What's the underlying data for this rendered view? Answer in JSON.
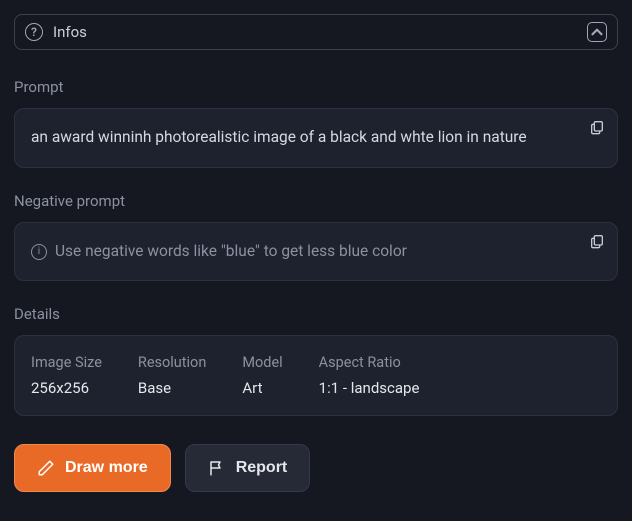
{
  "panel": {
    "title": "Infos"
  },
  "prompt": {
    "label": "Prompt",
    "value": "an award winninh photorealistic image of a black and whte lion in nature"
  },
  "negative_prompt": {
    "label": "Negative prompt",
    "placeholder": "Use negative words like \"blue\" to get less blue color"
  },
  "details": {
    "label": "Details",
    "items": [
      {
        "label": "Image Size",
        "value": "256x256"
      },
      {
        "label": "Resolution",
        "value": "Base"
      },
      {
        "label": "Model",
        "value": "Art"
      },
      {
        "label": "Aspect Ratio",
        "value": "1:1 - landscape"
      }
    ]
  },
  "actions": {
    "draw_more": "Draw more",
    "report": "Report"
  }
}
